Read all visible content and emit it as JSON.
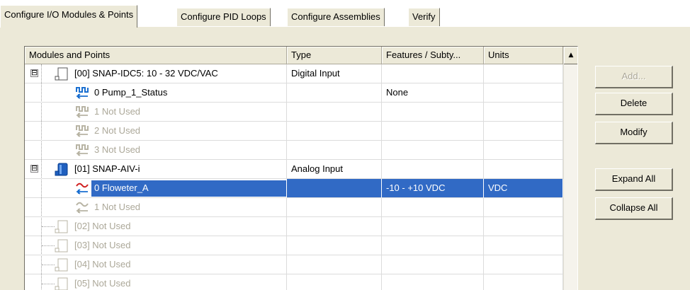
{
  "tabs": [
    {
      "label": "Configure I/O Modules & Points",
      "active": true
    },
    {
      "label": "Configure PID Loops"
    },
    {
      "label": "Configure Assemblies"
    },
    {
      "label": "Verify"
    }
  ],
  "table": {
    "headers": [
      "Modules and Points",
      "Type",
      "Features / Subty...",
      "Units"
    ],
    "rows": [
      {
        "name": "[00] SNAP-IDC5: 10 - 32 VDC/VAC",
        "type": "Digital Input",
        "features": "",
        "units": ""
      },
      {
        "name": "0 Pump_1_Status",
        "type": "",
        "features": "None",
        "units": ""
      },
      {
        "name": "1 Not Used",
        "type": "",
        "features": "",
        "units": ""
      },
      {
        "name": "2 Not Used",
        "type": "",
        "features": "",
        "units": ""
      },
      {
        "name": "3 Not Used",
        "type": "",
        "features": "",
        "units": ""
      },
      {
        "name": "[01] SNAP-AIV-i",
        "type": "Analog Input",
        "features": "",
        "units": ""
      },
      {
        "name": "0 Floweter_A",
        "type": "",
        "features": "-10 - +10 VDC",
        "units": "VDC"
      },
      {
        "name": "1 Not Used",
        "type": "",
        "features": "",
        "units": ""
      },
      {
        "name": "[02] Not Used",
        "type": "",
        "features": "",
        "units": ""
      },
      {
        "name": "[03] Not Used",
        "type": "",
        "features": "",
        "units": ""
      },
      {
        "name": "[04] Not Used",
        "type": "",
        "features": "",
        "units": ""
      },
      {
        "name": "[05] Not Used",
        "type": "",
        "features": "",
        "units": ""
      }
    ]
  },
  "buttons": {
    "add": "Add...",
    "delete": "Delete",
    "modify": "Modify",
    "expand_all": "Expand All",
    "collapse_all": "Collapse All"
  },
  "expander_symbol": "⊟",
  "scroll_up_symbol": "▲",
  "colors": {
    "selection": "#316ac5",
    "dialog_bg": "#ece9d8",
    "disabled_text": "#aca899",
    "module_icon_active": "#1f5fbf"
  }
}
